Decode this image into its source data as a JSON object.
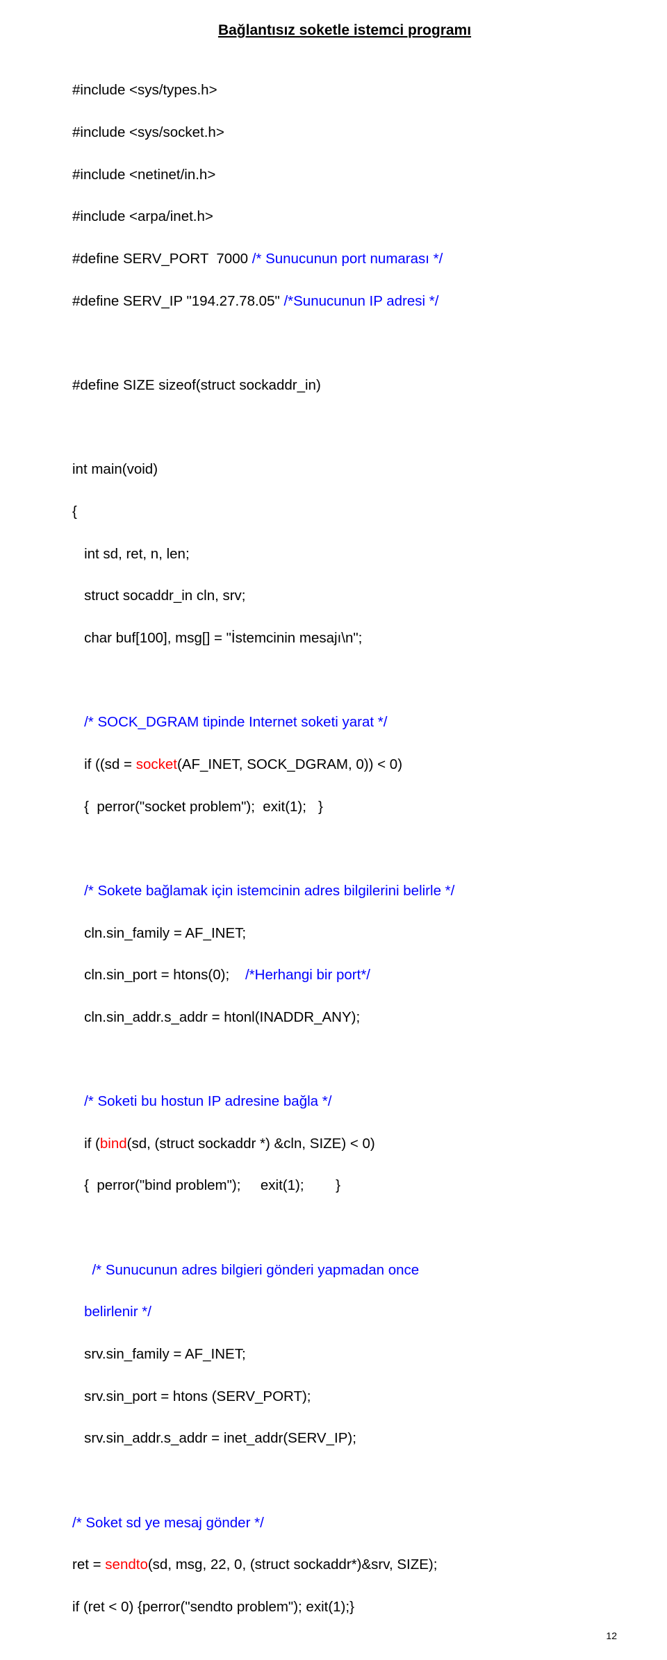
{
  "title": "Bağlantısız soketle istemci programı",
  "lines": {
    "l1": "#include <sys/types.h>",
    "l2": "#include <sys/socket.h>",
    "l3": "#include <netinet/in.h>",
    "l4": "#include <arpa/inet.h>",
    "l5a": "#define SERV_PORT  7000 ",
    "l5b": "/* Sunucunun port numarası */",
    "l6a": "#define SERV_IP \"194.27.78.05\" ",
    "l6b": "/*Sunucunun IP adresi */",
    "l7": "#define SIZE sizeof(struct sockaddr_in)",
    "l8": "int main(void)",
    "l9": "{",
    "l10": "   int sd, ret, n, len;",
    "l11": "   struct socaddr_in cln, srv;",
    "l12": "   char buf[100], msg[] = \"İstemcinin mesajı\\n\";",
    "l13": "   /* SOCK_DGRAM tipinde Internet soketi yarat */",
    "l14a": "   if ((sd = ",
    "l14b": "socket",
    "l14c": "(AF_INET, SOCK_DGRAM, 0)) < 0)",
    "l15": "   {  perror(\"socket problem\");  exit(1);   }",
    "l16": "   /* Sokete bağlamak için istemcinin adres bilgilerini belirle */",
    "l17": "   cln.sin_family = AF_INET;",
    "l18a": "   cln.sin_port = htons(0);    ",
    "l18b": "/*Herhangi bir port*/",
    "l19": "   cln.sin_addr.s_addr = htonl(INADDR_ANY);",
    "l20": "   /* Soketi bu hostun IP adresine bağla */",
    "l21a": "   if (",
    "l21b": "bind",
    "l21c": "(sd, (struct sockaddr *) &cln, SIZE) < 0)",
    "l22": "   {  perror(\"bind problem\");     exit(1);        }",
    "l23a": "     /* Sunucunun adres bilgieri gönderi yapmadan once",
    "l23b": "   belirlenir */",
    "l24": "   srv.sin_family = AF_INET;",
    "l25": "   srv.sin_port = htons (SERV_PORT);",
    "l26": "   srv.sin_addr.s_addr = inet_addr(SERV_IP);",
    "l27": "/* Soket sd ye mesaj gönder */",
    "l28a": "ret = ",
    "l28b": "sendto",
    "l28c": "(sd, msg, 22, 0, (struct sockaddr*)&srv, SIZE);",
    "l29": "if (ret < 0) {perror(\"sendto problem\"); exit(1);}"
  },
  "pagenum": "12"
}
